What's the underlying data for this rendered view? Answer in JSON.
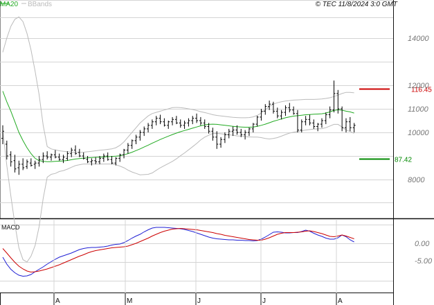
{
  "header": {
    "legend": [
      {
        "label": "MA20",
        "color": "#22aa22"
      },
      {
        "label": "BBands",
        "color": "#bbbbbb"
      }
    ],
    "copyright": "© TEC 11/8/2024 3:0 GMT"
  },
  "colors": {
    "bars": "#000000",
    "ma20": "#22aa22",
    "bbands": "#bbbbbb",
    "resistance": "#cc0000",
    "support": "#008800",
    "macd": "#1f1fd4",
    "signal": "#cc0000",
    "grid": "#d4d4d4"
  },
  "chart_data": [
    {
      "type": "ohlc",
      "name": "price",
      "y_ticks": [
        "14000",
        "12000",
        "11000",
        "10000",
        "8000"
      ],
      "levels": [
        {
          "label": "116.45",
          "value": 116.45,
          "color": "#cc0000"
        },
        {
          "label": "87.42",
          "value": 87.42,
          "color": "#008800"
        }
      ],
      "x_months": [
        "A",
        "M",
        "J",
        "J",
        "A"
      ],
      "bars": [
        [
          97.5,
          103.0,
          95.0,
          100.5
        ],
        [
          95.0,
          96.5,
          88.5,
          90.0
        ],
        [
          90.5,
          92.0,
          85.5,
          87.5
        ],
        [
          88.0,
          90.5,
          83.0,
          84.5
        ],
        [
          85.0,
          88.0,
          82.0,
          86.5
        ],
        [
          86.5,
          89.0,
          84.0,
          85.0
        ],
        [
          85.5,
          88.5,
          84.5,
          87.5
        ],
        [
          87.0,
          89.0,
          85.5,
          86.0
        ],
        [
          86.5,
          88.0,
          84.5,
          87.0
        ],
        [
          87.0,
          90.0,
          85.5,
          88.5
        ],
        [
          88.5,
          91.5,
          87.0,
          90.0
        ],
        [
          90.0,
          92.0,
          88.5,
          89.5
        ],
        [
          89.5,
          91.0,
          88.0,
          90.5
        ],
        [
          90.5,
          92.5,
          89.0,
          89.5
        ],
        [
          89.5,
          91.0,
          88.0,
          88.5
        ],
        [
          88.5,
          90.5,
          87.0,
          89.5
        ],
        [
          89.0,
          92.0,
          88.0,
          91.0
        ],
        [
          91.0,
          93.5,
          89.5,
          92.5
        ],
        [
          92.5,
          94.5,
          90.5,
          91.0
        ],
        [
          91.5,
          93.0,
          89.5,
          90.0
        ],
        [
          90.0,
          91.5,
          88.5,
          89.0
        ],
        [
          88.5,
          90.0,
          87.0,
          87.5
        ],
        [
          87.5,
          89.0,
          86.0,
          88.0
        ],
        [
          88.0,
          89.5,
          86.5,
          87.5
        ],
        [
          87.5,
          90.0,
          86.5,
          89.0
        ],
        [
          89.0,
          91.0,
          87.5,
          90.0
        ],
        [
          90.0,
          91.5,
          88.0,
          88.5
        ],
        [
          88.5,
          90.0,
          86.5,
          87.0
        ],
        [
          87.0,
          89.5,
          86.0,
          89.0
        ],
        [
          89.0,
          91.0,
          87.5,
          90.5
        ],
        [
          90.5,
          93.0,
          89.0,
          92.5
        ],
        [
          92.5,
          95.5,
          91.0,
          94.5
        ],
        [
          94.5,
          97.0,
          93.0,
          96.5
        ],
        [
          96.5,
          99.0,
          95.0,
          98.0
        ],
        [
          98.0,
          101.0,
          96.5,
          100.0
        ],
        [
          100.0,
          102.5,
          98.5,
          101.5
        ],
        [
          101.5,
          104.0,
          100.0,
          103.0
        ],
        [
          103.0,
          105.5,
          101.5,
          104.5
        ],
        [
          104.5,
          107.0,
          103.0,
          106.0
        ],
        [
          106.0,
          107.5,
          103.5,
          104.5
        ],
        [
          104.5,
          106.0,
          102.5,
          103.0
        ],
        [
          103.0,
          105.0,
          101.5,
          104.5
        ],
        [
          104.5,
          106.5,
          103.0,
          105.5
        ],
        [
          105.5,
          107.0,
          103.5,
          104.0
        ],
        [
          104.0,
          105.5,
          102.0,
          103.0
        ],
        [
          103.0,
          105.0,
          101.5,
          104.0
        ],
        [
          104.0,
          106.0,
          102.5,
          105.0
        ],
        [
          105.0,
          107.0,
          103.5,
          106.0
        ],
        [
          106.0,
          108.0,
          104.0,
          105.0
        ],
        [
          105.0,
          106.5,
          103.0,
          104.0
        ],
        [
          104.0,
          105.5,
          101.5,
          102.5
        ],
        [
          102.5,
          104.0,
          99.5,
          100.5
        ],
        [
          100.5,
          102.0,
          96.5,
          98.0
        ],
        [
          98.0,
          100.5,
          93.0,
          95.0
        ],
        [
          95.0,
          98.0,
          93.5,
          97.0
        ],
        [
          97.0,
          100.0,
          95.5,
          99.0
        ],
        [
          99.0,
          101.5,
          97.5,
          100.5
        ],
        [
          100.5,
          102.5,
          98.5,
          101.0
        ],
        [
          101.0,
          103.0,
          99.0,
          100.0
        ],
        [
          100.0,
          101.5,
          98.0,
          99.0
        ],
        [
          99.0,
          101.0,
          97.0,
          100.0
        ],
        [
          100.0,
          102.0,
          98.5,
          101.5
        ],
        [
          101.5,
          104.0,
          100.0,
          103.5
        ],
        [
          103.5,
          107.0,
          102.5,
          106.5
        ],
        [
          106.5,
          110.0,
          105.0,
          109.0
        ],
        [
          109.0,
          112.0,
          107.5,
          111.0
        ],
        [
          111.0,
          113.5,
          109.5,
          112.0
        ],
        [
          112.0,
          113.0,
          108.0,
          109.0
        ],
        [
          109.0,
          110.5,
          106.0,
          107.0
        ],
        [
          107.0,
          109.5,
          105.5,
          108.5
        ],
        [
          108.5,
          111.5,
          107.0,
          110.5
        ],
        [
          110.5,
          112.5,
          108.5,
          109.5
        ],
        [
          109.5,
          111.0,
          107.5,
          108.0
        ],
        [
          108.0,
          109.5,
          100.0,
          101.0
        ],
        [
          101.0,
          105.5,
          100.0,
          104.5
        ],
        [
          104.5,
          107.0,
          103.0,
          105.5
        ],
        [
          105.5,
          107.5,
          103.0,
          104.0
        ],
        [
          104.0,
          105.5,
          101.5,
          102.5
        ],
        [
          102.5,
          104.0,
          100.5,
          103.5
        ],
        [
          103.5,
          106.0,
          102.0,
          105.0
        ],
        [
          105.0,
          108.5,
          103.5,
          107.5
        ],
        [
          107.5,
          111.0,
          106.0,
          109.5
        ],
        [
          109.5,
          122.0,
          108.5,
          116.5
        ],
        [
          116.5,
          118.0,
          108.0,
          110.0
        ],
        [
          110.0,
          111.0,
          100.5,
          102.0
        ],
        [
          102.0,
          106.0,
          100.0,
          104.5
        ],
        [
          104.5,
          106.5,
          100.5,
          102.0
        ],
        [
          102.0,
          104.0,
          100.0,
          103.0
        ]
      ],
      "ma20": [
        117.5,
        113.0,
        109.0,
        104.5,
        100.0,
        96.5,
        93.5,
        91.0,
        89.0,
        88.0,
        87.7,
        87.6,
        87.6,
        87.7,
        87.8,
        87.9,
        88.1,
        88.4,
        88.7,
        88.9,
        89.1,
        89.2,
        89.3,
        89.4,
        89.5,
        89.6,
        89.7,
        89.8,
        89.9,
        90.1,
        90.5,
        91.0,
        91.6,
        92.3,
        93.0,
        93.8,
        94.6,
        95.4,
        96.2,
        97.0,
        97.7,
        98.4,
        99.1,
        99.7,
        100.3,
        100.8,
        101.3,
        101.8,
        102.3,
        102.8,
        103.2,
        103.4,
        103.5,
        103.4,
        103.2,
        103.0,
        102.8,
        102.6,
        102.4,
        102.3,
        102.2,
        102.2,
        102.3,
        102.6,
        103.0,
        103.5,
        104.1,
        104.7,
        105.2,
        105.7,
        106.2,
        106.6,
        106.9,
        107.1,
        107.3,
        107.5,
        107.6,
        107.7,
        107.8,
        107.9,
        108.2,
        108.7,
        109.3,
        109.6,
        109.4,
        109.0,
        108.7,
        108.2
      ],
      "bb_upper": [
        134.0,
        140.0,
        145.0,
        148.0,
        149.0,
        147.0,
        142.0,
        135.0,
        126.0,
        116.0,
        103.0,
        94.0,
        93.0,
        92.6,
        92.2,
        92.0,
        91.8,
        91.6,
        91.5,
        91.5,
        91.6,
        91.8,
        92.0,
        92.2,
        92.4,
        92.6,
        92.8,
        93.0,
        93.5,
        94.5,
        96.0,
        98.0,
        100.0,
        102.0,
        104.0,
        105.5,
        107.0,
        108.0,
        108.5,
        109.0,
        109.5,
        110.0,
        110.5,
        110.6,
        110.5,
        110.3,
        110.0,
        109.7,
        109.3,
        108.8,
        108.4,
        108.0,
        107.5,
        107.2,
        107.0,
        106.8,
        106.6,
        106.4,
        106.3,
        106.2,
        106.2,
        106.3,
        106.6,
        107.2,
        108.2,
        109.6,
        111.0,
        112.0,
        112.6,
        113.0,
        113.3,
        113.5,
        113.7,
        113.8,
        113.9,
        114.0,
        114.0,
        114.0,
        114.1,
        114.2,
        114.4,
        114.7,
        115.2,
        115.8,
        116.5,
        117.0,
        117.0,
        116.8
      ],
      "bb_lower": [
        101.0,
        86.0,
        73.0,
        61.0,
        51.0,
        46.0,
        45.0,
        47.5,
        52.0,
        60.0,
        72.0,
        81.0,
        82.2,
        82.6,
        83.4,
        83.8,
        84.4,
        85.2,
        85.9,
        86.3,
        86.6,
        86.6,
        86.6,
        86.6,
        86.6,
        86.6,
        86.6,
        86.6,
        86.3,
        85.7,
        85.0,
        84.0,
        83.2,
        82.6,
        82.0,
        82.1,
        82.2,
        82.8,
        83.9,
        85.0,
        85.9,
        86.8,
        87.7,
        88.8,
        90.1,
        91.3,
        92.6,
        93.9,
        95.3,
        96.8,
        98.0,
        98.8,
        99.5,
        99.6,
        99.4,
        99.2,
        99.0,
        98.8,
        98.5,
        98.4,
        98.2,
        98.1,
        98.0,
        98.0,
        97.8,
        97.4,
        97.2,
        97.4,
        97.8,
        98.4,
        99.1,
        99.7,
        100.1,
        100.4,
        100.7,
        101.0,
        101.2,
        101.4,
        101.5,
        101.6,
        102.0,
        102.7,
        103.4,
        103.4,
        102.3,
        101.0,
        100.4,
        99.6
      ]
    },
    {
      "type": "line",
      "name": "MACD",
      "y_ticks": [
        "0.00",
        "-5.00"
      ],
      "series": [
        {
          "name": "MACD",
          "color": "#1f1fd4",
          "values": [
            -4.0,
            -6.0,
            -7.5,
            -8.5,
            -9.2,
            -9.5,
            -9.4,
            -9.0,
            -8.2,
            -7.5,
            -6.8,
            -6.0,
            -5.3,
            -4.6,
            -4.0,
            -3.6,
            -3.2,
            -2.8,
            -2.3,
            -1.8,
            -1.5,
            -1.3,
            -1.2,
            -1.2,
            -1.1,
            -1.0,
            -0.8,
            -0.5,
            -0.3,
            -0.2,
            0.2,
            0.8,
            1.5,
            2.1,
            2.6,
            3.3,
            3.9,
            4.4,
            4.6,
            4.6,
            4.6,
            4.5,
            4.4,
            4.3,
            4.2,
            4.0,
            3.7,
            3.4,
            3.0,
            2.6,
            2.2,
            1.8,
            1.5,
            1.3,
            1.2,
            1.1,
            1.0,
            1.0,
            0.9,
            0.9,
            0.8,
            0.8,
            0.7,
            0.8,
            1.2,
            1.8,
            2.5,
            3.2,
            3.3,
            3.2,
            3.0,
            3.0,
            3.1,
            3.1,
            3.4,
            3.8,
            3.5,
            2.9,
            2.4,
            2.0,
            1.5,
            1.2,
            1.2,
            1.6,
            2.4,
            1.9,
            1.0,
            0.4
          ]
        },
        {
          "name": "Signal",
          "color": "#cc0000",
          "values": [
            -1.5,
            -2.8,
            -4.2,
            -5.5,
            -6.6,
            -7.4,
            -8.0,
            -8.3,
            -8.2,
            -8.0,
            -7.7,
            -7.4,
            -7.0,
            -6.6,
            -6.2,
            -5.7,
            -5.2,
            -4.7,
            -4.2,
            -3.7,
            -3.3,
            -2.8,
            -2.4,
            -2.1,
            -1.9,
            -1.7,
            -1.5,
            -1.3,
            -1.2,
            -1.1,
            -1.0,
            -0.8,
            -0.4,
            0.0,
            0.5,
            1.0,
            1.5,
            2.1,
            2.6,
            3.1,
            3.5,
            3.8,
            4.1,
            4.2,
            4.3,
            4.2,
            4.1,
            4.0,
            3.9,
            3.7,
            3.5,
            3.3,
            3.1,
            2.8,
            2.6,
            2.3,
            2.1,
            1.9,
            1.7,
            1.5,
            1.3,
            1.1,
            1.0,
            0.9,
            0.9,
            1.2,
            1.6,
            2.1,
            2.6,
            2.9,
            3.1,
            3.1,
            3.1,
            3.2,
            3.3,
            3.5,
            3.6,
            3.4,
            3.1,
            2.8,
            2.4,
            2.0,
            1.9,
            2.1,
            2.4,
            2.1,
            1.7,
            1.3
          ]
        }
      ]
    }
  ]
}
